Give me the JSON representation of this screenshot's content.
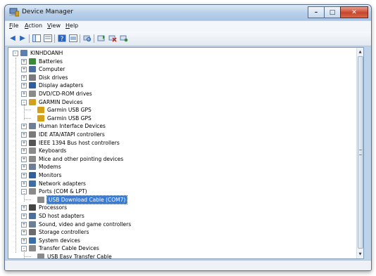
{
  "window": {
    "title": "Device Manager"
  },
  "caption": {
    "minimize": "–",
    "maximize": "□",
    "close": "✕"
  },
  "menu": [
    {
      "accel": "F",
      "rest": "ile"
    },
    {
      "accel": "A",
      "rest": "ction"
    },
    {
      "accel": "V",
      "rest": "iew"
    },
    {
      "accel": "H",
      "rest": "elp"
    }
  ],
  "toolbar": {
    "icons": [
      "back-icon",
      "forward-icon",
      "console-tree-icon",
      "properties-icon",
      "help-icon",
      "view-icon",
      "scan-hardware-icon",
      "update-driver-icon",
      "disable-icon",
      "uninstall-icon"
    ]
  },
  "tree": [
    {
      "label": "KINHDOANH",
      "level": 0,
      "expander": "–",
      "icon": "computer-icon",
      "color": "#5b7fb0"
    },
    {
      "label": "Batteries",
      "level": 1,
      "expander": "+",
      "icon": "battery-icon",
      "color": "#3a8a3a"
    },
    {
      "label": "Computer",
      "level": 1,
      "expander": "+",
      "icon": "computer-icon",
      "color": "#4a6e9e"
    },
    {
      "label": "Disk drives",
      "level": 1,
      "expander": "+",
      "icon": "disk-icon",
      "color": "#7a7a7a"
    },
    {
      "label": "Display adapters",
      "level": 1,
      "expander": "+",
      "icon": "display-icon",
      "color": "#2f5f9f"
    },
    {
      "label": "DVD/CD-ROM drives",
      "level": 1,
      "expander": "+",
      "icon": "dvd-icon",
      "color": "#8a8a8a"
    },
    {
      "label": "GARMIN Devices",
      "level": 1,
      "expander": "–",
      "icon": "device-folder-icon",
      "color": "#d4a017"
    },
    {
      "label": "Garmin USB GPS",
      "level": 2,
      "expander": "",
      "icon": "gps-icon",
      "color": "#d4a017"
    },
    {
      "label": "Garmin USB GPS",
      "level": 2,
      "expander": "",
      "icon": "gps-icon",
      "color": "#d4a017"
    },
    {
      "label": "Human Interface Devices",
      "level": 1,
      "expander": "+",
      "icon": "hid-icon",
      "color": "#6b7f99"
    },
    {
      "label": "IDE ATA/ATAPI controllers",
      "level": 1,
      "expander": "+",
      "icon": "ide-icon",
      "color": "#7a7a7a"
    },
    {
      "label": "IEEE 1394 Bus host controllers",
      "level": 1,
      "expander": "+",
      "icon": "firewire-icon",
      "color": "#555555"
    },
    {
      "label": "Keyboards",
      "level": 1,
      "expander": "+",
      "icon": "keyboard-icon",
      "color": "#8a8a8a"
    },
    {
      "label": "Mice and other pointing devices",
      "level": 1,
      "expander": "+",
      "icon": "mouse-icon",
      "color": "#8a8a8a"
    },
    {
      "label": "Modems",
      "level": 1,
      "expander": "+",
      "icon": "modem-icon",
      "color": "#6b7f99"
    },
    {
      "label": "Monitors",
      "level": 1,
      "expander": "+",
      "icon": "monitor-icon",
      "color": "#2f5f9f"
    },
    {
      "label": "Network adapters",
      "level": 1,
      "expander": "+",
      "icon": "network-icon",
      "color": "#3a6ea5"
    },
    {
      "label": "Ports (COM & LPT)",
      "level": 1,
      "expander": "–",
      "icon": "port-icon",
      "color": "#8a8a8a"
    },
    {
      "label": "USB Download Cable (COM7)",
      "level": 2,
      "expander": "",
      "icon": "port-icon",
      "color": "#8a8a8a",
      "selected": true
    },
    {
      "label": "Processors",
      "level": 1,
      "expander": "+",
      "icon": "processor-icon",
      "color": "#444444"
    },
    {
      "label": "SD host adapters",
      "level": 1,
      "expander": "+",
      "icon": "sd-icon",
      "color": "#4a6e9e"
    },
    {
      "label": "Sound, video and game controllers",
      "level": 1,
      "expander": "+",
      "icon": "sound-icon",
      "color": "#6b7f99"
    },
    {
      "label": "Storage controllers",
      "level": 1,
      "expander": "+",
      "icon": "storage-icon",
      "color": "#6b6b6b"
    },
    {
      "label": "System devices",
      "level": 1,
      "expander": "+",
      "icon": "system-icon",
      "color": "#3a6ea5"
    },
    {
      "label": "Transfer Cable Devices",
      "level": 1,
      "expander": "–",
      "icon": "cable-icon",
      "color": "#8a8a8a"
    },
    {
      "label": "USB Easy Transfer Cable",
      "level": 2,
      "expander": "",
      "icon": "cable-icon",
      "color": "#8a8a8a"
    }
  ]
}
